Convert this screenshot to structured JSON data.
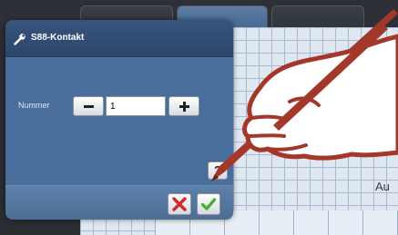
{
  "dialog": {
    "title": "S88-Kontakt",
    "nummer_label": "Nummer",
    "nummer_value": "1",
    "help_label": "?"
  },
  "background": {
    "partial_text": "Au"
  },
  "icons": {
    "header": "wrench-icon",
    "cancel": "close-icon",
    "ok": "check-icon",
    "overlay": "hand-with-pen-icon"
  },
  "colors": {
    "dialog_bg": "#4a6e9c",
    "header_bg": "#2c4669",
    "cancel_red": "#d42a2a",
    "ok_green": "#4caf3a",
    "pen_red": "#a3372a"
  }
}
